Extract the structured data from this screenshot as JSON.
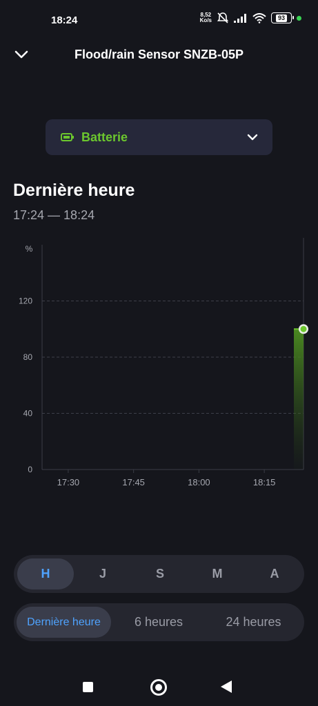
{
  "status": {
    "time": "18:24",
    "speed_value": "8,52",
    "speed_unit": "Ko/s",
    "battery_level": "93",
    "wifi_label": "6"
  },
  "header": {
    "title": "Flood/rain Sensor SNZB-05P"
  },
  "selector": {
    "label": "Batterie",
    "accent": "#6cc72e"
  },
  "period": {
    "title": "Dernière heure",
    "range": "17:24 — 18:24"
  },
  "chart_data": {
    "type": "area",
    "ylabel": "%",
    "yticks": [
      "0",
      "40",
      "80",
      "120"
    ],
    "ylim": [
      0,
      160
    ],
    "xticks": [
      "17:30",
      "17:45",
      "18:00",
      "18:15"
    ],
    "x": [
      "18:24"
    ],
    "values": [
      100
    ],
    "series_color": "#6cc72e",
    "grid": "horizontal dashed"
  },
  "granularity": {
    "tabs": [
      {
        "label": "H",
        "active": true
      },
      {
        "label": "J",
        "active": false
      },
      {
        "label": "S",
        "active": false
      },
      {
        "label": "M",
        "active": false
      },
      {
        "label": "A",
        "active": false
      }
    ]
  },
  "ranges": {
    "tabs": [
      {
        "label": "Dernière heure",
        "active": true
      },
      {
        "label": "6 heures",
        "active": false
      },
      {
        "label": "24 heures",
        "active": false
      }
    ]
  },
  "colors": {
    "background": "#15161c",
    "active_tab_text": "#4fa3ff"
  }
}
